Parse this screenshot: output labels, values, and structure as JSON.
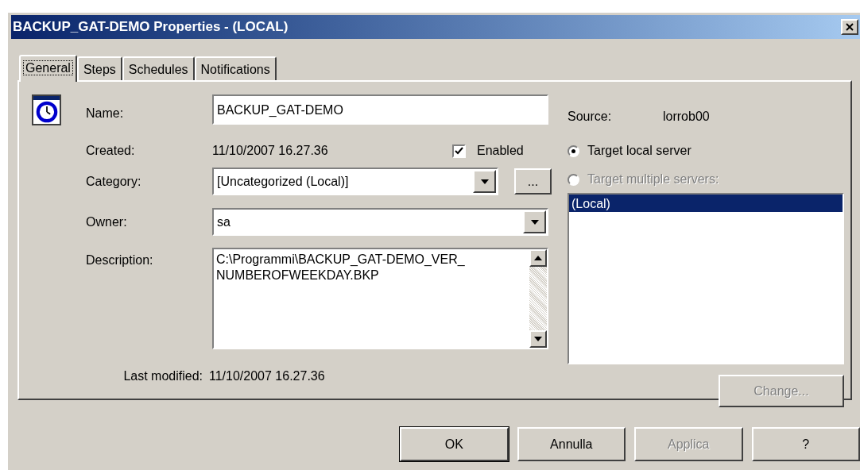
{
  "window": {
    "title": "BACKUP_GAT-DEMO Properties - (LOCAL)"
  },
  "tabs": [
    {
      "label": "General",
      "selected": true
    },
    {
      "label": "Steps",
      "selected": false
    },
    {
      "label": "Schedules",
      "selected": false
    },
    {
      "label": "Notifications",
      "selected": false
    }
  ],
  "name": {
    "label": "Name:",
    "value": "BACKUP_GAT-DEMO"
  },
  "created": {
    "label": "Created:",
    "value": "11/10/2007 16.27.36"
  },
  "enabled": {
    "label": "Enabled",
    "checked": true
  },
  "category": {
    "label": "Category:",
    "value": "[Uncategorized (Local)]",
    "browse_button": "..."
  },
  "owner": {
    "label": "Owner:",
    "value": "sa"
  },
  "description": {
    "label": "Description:",
    "value": "C:\\Programmi\\BACKUP_GAT-DEMO_VER_\nNUMBEROFWEEKDAY.BKP"
  },
  "last_modified": {
    "label": "Last modified:",
    "value": "11/10/2007 16.27.36"
  },
  "source": {
    "label": "Source:",
    "value": "lorrob00"
  },
  "targets": [
    {
      "label": "Target local server",
      "selected": true,
      "disabled": false
    },
    {
      "label": "Target multiple servers:",
      "selected": false,
      "disabled": true
    }
  ],
  "servers": [
    {
      "label": "(Local)",
      "selected": true
    }
  ],
  "change_button": {
    "label": "Change...",
    "disabled": true
  },
  "buttons": [
    {
      "label": "OK",
      "disabled": false
    },
    {
      "label": "Annulla",
      "disabled": false
    },
    {
      "label": "Applica",
      "disabled": true
    },
    {
      "label": "?",
      "disabled": false
    }
  ]
}
